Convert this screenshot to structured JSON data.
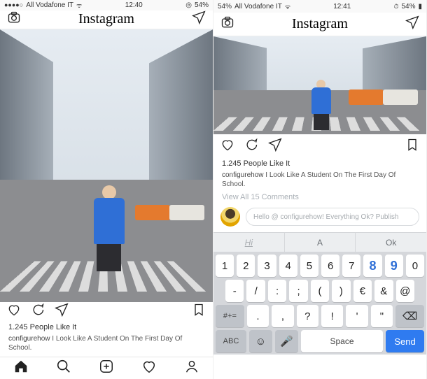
{
  "left": {
    "status": {
      "carrier": "All Vodafone IT",
      "time": "12:40",
      "battery": "54%",
      "battery_icon": "◎"
    },
    "header": {
      "logo": "Instagram"
    },
    "actions": {
      "like": "heart",
      "comment": "speech",
      "share": "paper-plane",
      "save": "bookmark"
    },
    "likes_line": "1.245 People Like It",
    "caption_user": "configurehow",
    "caption_text": "I Look Like A Student On The First Day Of School.",
    "tabs": [
      "home",
      "search",
      "add",
      "activity",
      "profile"
    ]
  },
  "right": {
    "status": {
      "battery_pct": "54%",
      "carrier": "All Vodafone IT",
      "time": "12:41",
      "battery": "54%"
    },
    "header": {
      "logo": "Instagram"
    },
    "likes_line": "1.245 People Like It",
    "caption_user": "configurehow",
    "caption_text": "I Look Like A Student On The First Day Of School.",
    "view_all": "View All 15 Comments",
    "comment_placeholder": "Hello @ configurehow! Everything Ok? Publish",
    "suggestions": [
      "Hi",
      "A",
      "Ok"
    ],
    "keyboard": {
      "row1": [
        "1",
        "2",
        "3",
        "4",
        "5",
        "6",
        "7",
        "8",
        "9",
        "0"
      ],
      "row2": [
        "-",
        "/",
        ":",
        ";",
        "(",
        ")",
        "€",
        "&",
        "@"
      ],
      "row3_shift": "#+=",
      "row3": [
        ".",
        ",",
        "?",
        "!",
        "'",
        "\""
      ],
      "row3_back": "⌫",
      "row4_abc": "ABC",
      "row4_emoji": "☺",
      "row4_mic": "🎤",
      "row4_space": "Space",
      "row4_send": "Send"
    }
  }
}
